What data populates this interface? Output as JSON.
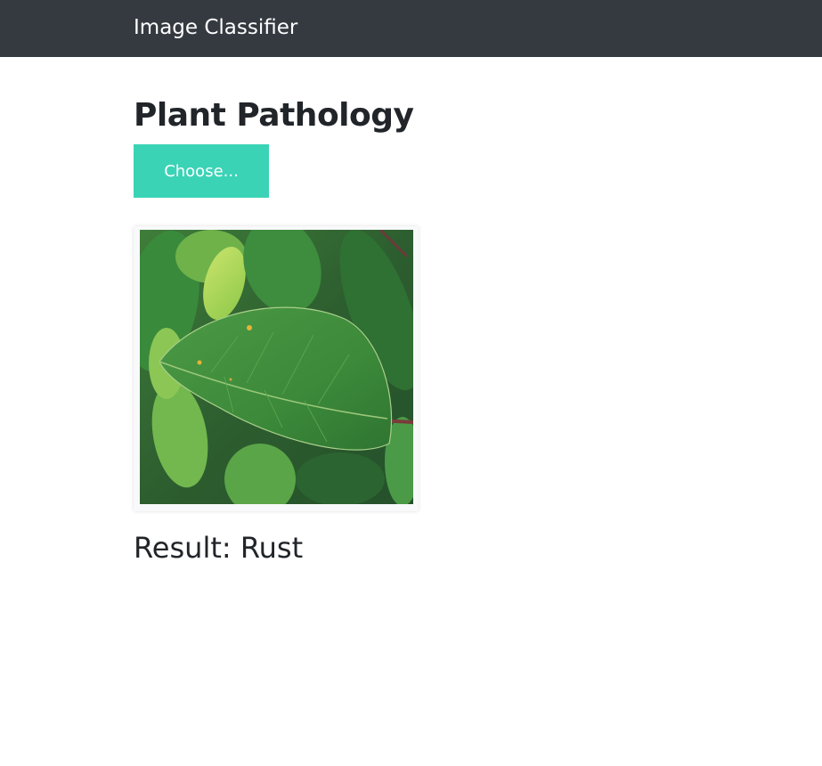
{
  "navbar": {
    "brand": "Image Classifier"
  },
  "main": {
    "title": "Plant Pathology",
    "choose_button_label": "Choose...",
    "result_prefix": "Result:",
    "result_value": "Rust"
  },
  "colors": {
    "navbar_bg": "#343a40",
    "button_bg": "#3bd3b6",
    "text": "#212529"
  }
}
